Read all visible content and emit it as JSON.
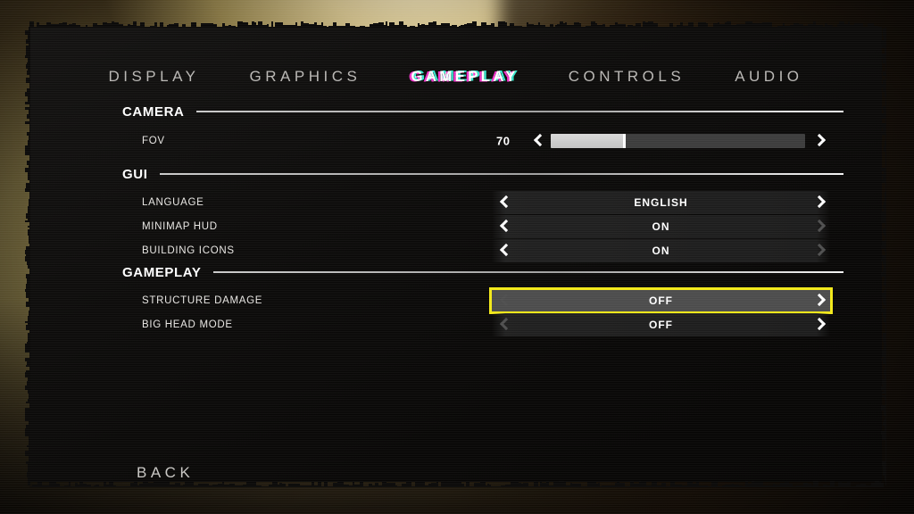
{
  "theme": {
    "highlight_color": "#f2e818",
    "panel_color": "#090807",
    "background_color": "#9c8c52",
    "text_color": "#ffffff",
    "dim_arrow_color": "#4e4e4e"
  },
  "tabs": [
    {
      "label": "DISPLAY",
      "selected": false
    },
    {
      "label": "GRAPHICS",
      "selected": false
    },
    {
      "label": "GAMEPLAY",
      "selected": true
    },
    {
      "label": "CONTROLS",
      "selected": false
    },
    {
      "label": "AUDIO",
      "selected": false
    }
  ],
  "sections": [
    {
      "title": "CAMERA",
      "rows": [
        {
          "label": "FOV",
          "type": "slider",
          "value": "70",
          "fill_percent": 29,
          "left_arrow": "enabled",
          "right_arrow": "enabled"
        }
      ]
    },
    {
      "title": "GUI",
      "rows": [
        {
          "label": "LANGUAGE",
          "type": "option",
          "value": "ENGLISH",
          "left_arrow": "enabled",
          "right_arrow": "enabled",
          "selected": false
        },
        {
          "label": "MINIMAP HUD",
          "type": "option",
          "value": "ON",
          "left_arrow": "enabled",
          "right_arrow": "disabled",
          "selected": false
        },
        {
          "label": "BUILDING ICONS",
          "type": "option",
          "value": "ON",
          "left_arrow": "enabled",
          "right_arrow": "disabled",
          "selected": false
        }
      ]
    },
    {
      "title": "GAMEPLAY",
      "rows": [
        {
          "label": "STRUCTURE DAMAGE",
          "type": "option",
          "value": "OFF",
          "left_arrow": "disabled",
          "right_arrow": "enabled",
          "selected": true
        },
        {
          "label": "BIG HEAD MODE",
          "type": "option",
          "value": "OFF",
          "left_arrow": "disabled",
          "right_arrow": "enabled",
          "selected": false
        }
      ]
    }
  ],
  "footer": {
    "back_label": "BACK"
  },
  "icons": {
    "left_arrow": "chevron-left-icon",
    "right_arrow": "chevron-right-icon"
  }
}
